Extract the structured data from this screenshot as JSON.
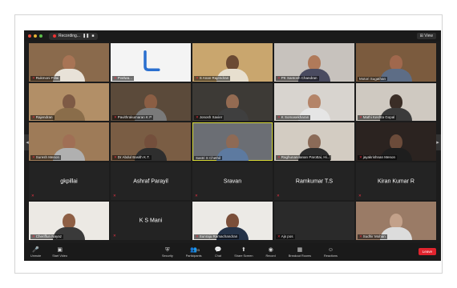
{
  "window": {
    "recording_label": "Recording...",
    "view_label": "View"
  },
  "colors": {
    "active_speaker": "#d6d835",
    "leave": "#e0242e",
    "mic_muted": "#e33344"
  },
  "participants": [
    {
      "name": "Rukmoni Pillai",
      "video": true,
      "muted": true,
      "bg": "#8a6a4c",
      "skin": "#a87455",
      "shirt": "#e8e2d8"
    },
    {
      "name": "Pvelwa...",
      "video": true,
      "muted": true,
      "bg": "#f4f4f4",
      "skin": "#f4f4f4",
      "shirt": "#f4f4f4",
      "logo": true
    },
    {
      "name": "S Anan Rajendran",
      "video": true,
      "muted": true,
      "bg": "#c9a66e",
      "skin": "#6b4a33",
      "shirt": "#e7dfcf"
    },
    {
      "name": "PK Santosh Chandran",
      "video": true,
      "muted": true,
      "bg": "#c7c2bd",
      "skin": "#b07a5a",
      "shirt": "#4a4b60"
    },
    {
      "name": "Motori Sugathan",
      "video": true,
      "muted": false,
      "bg": "#7b5b3e",
      "skin": "#a0684d",
      "shirt": "#5d6d86"
    },
    {
      "name": "Rajendran",
      "video": true,
      "muted": true,
      "bg": "#b28f67",
      "skin": "#7e5a45",
      "shirt": "#8a6d4a"
    },
    {
      "name": "Pavithrakumaran K P",
      "video": true,
      "muted": true,
      "bg": "#5b4a3a",
      "skin": "#8b5e44",
      "shirt": "#7a7a7a"
    },
    {
      "name": "Jonosh Xavier",
      "video": true,
      "muted": true,
      "bg": "#3d3a36",
      "skin": "#946b52",
      "shirt": "#3f3f3f"
    },
    {
      "name": "K Somasekharan",
      "video": true,
      "muted": true,
      "bg": "#d8d4cf",
      "skin": "#b48468",
      "shirt": "#e5e5e5"
    },
    {
      "name": "Mathi Keshta Gopal",
      "video": true,
      "muted": true,
      "bg": "#cfc9c1",
      "skin": "#3a2d26",
      "shirt": "#3b3b3b"
    },
    {
      "name": "Suresh Menon",
      "video": true,
      "muted": true,
      "bg": "#9e7b58",
      "skin": "#a06f55",
      "shirt": "#b0b0b0"
    },
    {
      "name": "Dr Abdul Basith K.T.",
      "video": true,
      "muted": true,
      "bg": "#7a5d44",
      "skin": "#744f3c",
      "shirt": "#2e2e2e"
    },
    {
      "name": "Sastri S Chethil",
      "video": true,
      "muted": false,
      "bg": "#6b6e74",
      "skin": "#8e6a55",
      "shirt": "#5d7aa0",
      "active": true
    },
    {
      "name": "Raghunandanan Parottai, Hi...",
      "video": true,
      "muted": true,
      "bg": "#d3ccc2",
      "skin": "#8b6b58",
      "shirt": "#2d2d2d"
    },
    {
      "name": "jayakrishnan Menon",
      "video": true,
      "muted": true,
      "bg": "#2b2320",
      "skin": "#6b4b3a",
      "shirt": "#1e1e1e"
    },
    {
      "name": "gkpillai",
      "video": false,
      "muted": true
    },
    {
      "name": "Ashraf Parayil",
      "video": false,
      "muted": true
    },
    {
      "name": "Sravan",
      "video": false,
      "muted": true
    },
    {
      "name": "Ramkumar T.S",
      "video": false,
      "muted": true
    },
    {
      "name": "Kiran Kumar R",
      "video": false,
      "muted": true
    },
    {
      "name": "Cheriffun Nayaz",
      "video": true,
      "muted": true,
      "bg": "#ece9e4",
      "skin": "#8e5f45",
      "shirt": "#3a3a3a"
    },
    {
      "name": "K S Mani",
      "video": false,
      "muted": true
    },
    {
      "name": "Sunraju Ramachandran",
      "video": true,
      "muted": true,
      "bg": "#eceae6",
      "skin": "#7b4f3a",
      "shirt": "#243247"
    },
    {
      "name": "Ajs pos",
      "video": true,
      "muted": true,
      "bg": "#2a2a2a",
      "skin": "#2a2a2a",
      "shirt": "#2a2a2a",
      "dark": true
    },
    {
      "name": "Sudhir Mohan",
      "video": true,
      "muted": true,
      "bg": "#9a7b66",
      "skin": "#c3a18a",
      "shirt": "#dcdcdc"
    }
  ],
  "toolbar": {
    "left": [
      {
        "icon": "mic-icon",
        "glyph": "🎤",
        "label": "Unmute"
      },
      {
        "icon": "video-icon",
        "glyph": "▣",
        "label": "Start Video"
      }
    ],
    "center": [
      {
        "icon": "security-icon",
        "glyph": "⛨",
        "label": "Security"
      },
      {
        "icon": "participants-icon",
        "glyph": "👥",
        "label": "Participants"
      },
      {
        "icon": "chat-icon",
        "glyph": "💬",
        "label": "Chat"
      },
      {
        "icon": "share-screen-icon",
        "glyph": "⬆",
        "label": "Share Screen"
      },
      {
        "icon": "record-icon",
        "glyph": "◉",
        "label": "Record"
      },
      {
        "icon": "breakout-icon",
        "glyph": "▦",
        "label": "Breakout Rooms"
      },
      {
        "icon": "reactions-icon",
        "glyph": "☺",
        "label": "Reactions"
      }
    ],
    "participants_count": "23",
    "leave_label": "Leave"
  }
}
